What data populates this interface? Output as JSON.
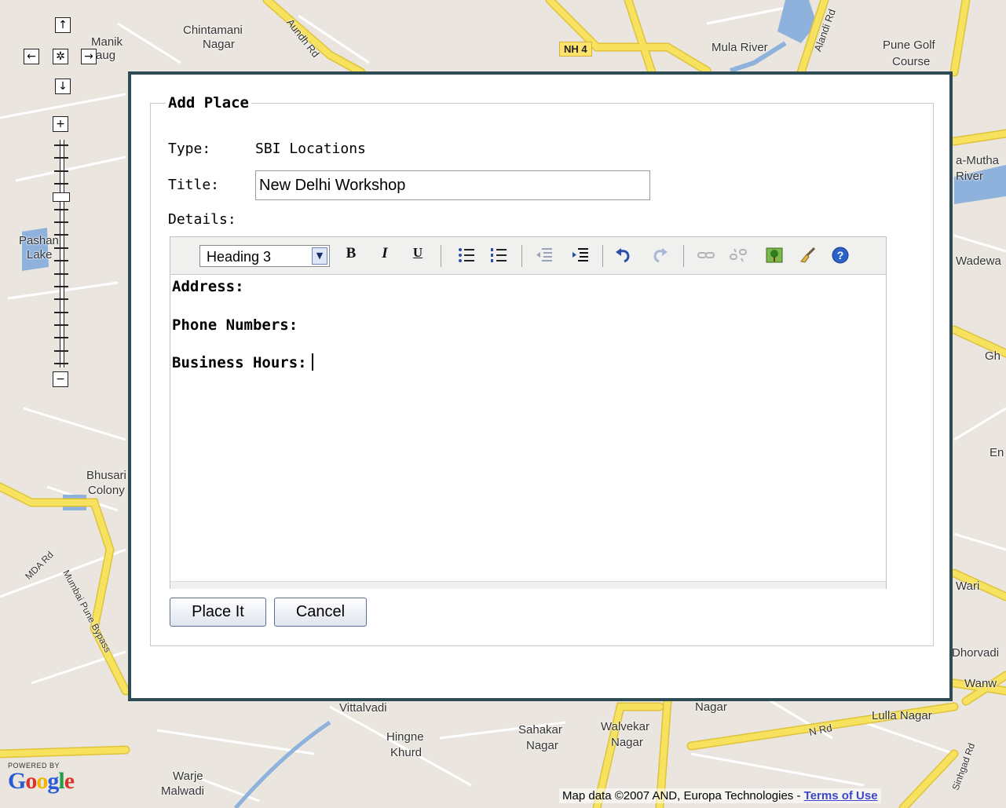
{
  "map": {
    "labels": [
      "Chintamani",
      "Nagar",
      "Manik",
      "Baug",
      "Aundh Rd",
      "Mula River",
      "Alandi Rd",
      "Pune Golf",
      "Course",
      "Pashan",
      "Lake",
      "a-Mutha",
      "River",
      "Wadewa",
      "Bhusari",
      "Colony",
      "MDA Rd",
      "Mumbai Pune Bypass",
      "Vittalvadi",
      "Hingne",
      "Khurd",
      "Sahakar",
      "Nagar",
      "Walvekar",
      "Nagar",
      "Nagar",
      "N Rd",
      "Lulla Nagar",
      "Warje",
      "Malwadi",
      "Gh",
      "En",
      "Wari",
      "Dhorvadi",
      "Wanw",
      "Sinhgad Rd"
    ],
    "highway_shield": "NH 4",
    "powered_by": "POWERED BY",
    "logo": "Google",
    "copyright": "Map data ©2007 AND, Europa Technologies - ",
    "terms_link": "Terms of Use",
    "controls": {
      "pan_up": "↑",
      "pan_left": "←",
      "pan_center": "✲",
      "pan_right": "→",
      "pan_down": "↓",
      "zoom_in": "+",
      "zoom_out": "−"
    },
    "zoom_level_fraction": 0.76
  },
  "dialog": {
    "legend": "Add Place",
    "type_label": "Type:",
    "type_value": "SBI Locations",
    "title_label": "Title:",
    "title_value": "New Delhi Workshop",
    "details_label": "Details:",
    "editor": {
      "format_selected": "Heading 3",
      "toolbar": {
        "bold": "B",
        "italic": "I",
        "underline": "U",
        "dropdown_arrow": "▼"
      },
      "icons": [
        "bold-icon",
        "italic-icon",
        "underline-icon",
        "bulleted-list-icon",
        "numbered-list-icon",
        "outdent-icon",
        "indent-icon",
        "undo-icon",
        "redo-icon",
        "link-icon",
        "unlink-icon",
        "image-icon",
        "cleanup-icon",
        "help-icon"
      ],
      "content": {
        "line1": "Address:",
        "line2": "Phone Numbers:",
        "line3": "Business Hours:"
      }
    },
    "buttons": {
      "place_it": "Place It",
      "cancel": "Cancel"
    }
  },
  "colors": {
    "dialog_border": "#2e4c56",
    "road_yellow": "#f7e25f",
    "road_outline": "#e0c23a",
    "water": "#8fb2dd",
    "map_bg": "#eae6df",
    "link_blue": "#3b47c7"
  }
}
